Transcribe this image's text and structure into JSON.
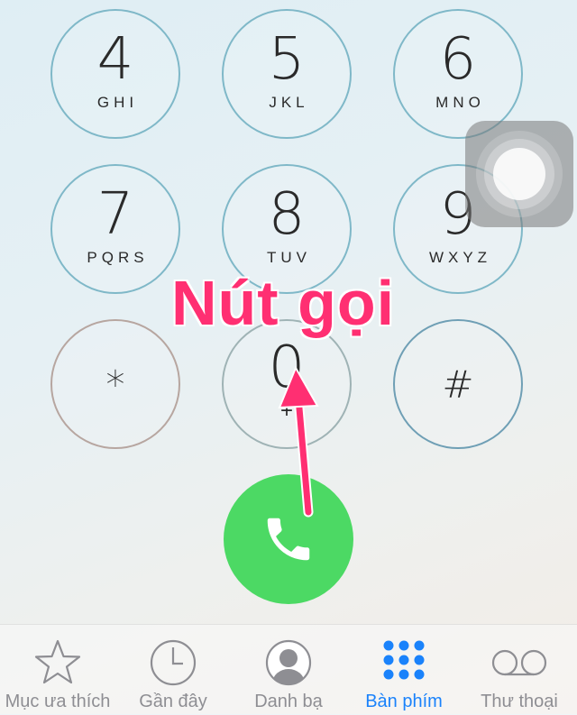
{
  "keypad": {
    "k4": {
      "digit": "4",
      "letters": "GHI"
    },
    "k5": {
      "digit": "5",
      "letters": "JKL"
    },
    "k6": {
      "digit": "6",
      "letters": "MNO"
    },
    "k7": {
      "digit": "7",
      "letters": "PQRS"
    },
    "k8": {
      "digit": "8",
      "letters": "TUV"
    },
    "k9": {
      "digit": "9",
      "letters": "WXYZ"
    },
    "kstar": {
      "symbol": "*"
    },
    "k0": {
      "digit": "0",
      "letters": "+"
    },
    "khash": {
      "symbol": "#"
    }
  },
  "call_button": {
    "icon": "phone-icon",
    "color": "#4cd964"
  },
  "annotation": {
    "text": "Nút gọi",
    "color": "#ff2f72"
  },
  "tabbar": {
    "favorites": "Mục ưa thích",
    "recents": "Gần đây",
    "contacts": "Danh bạ",
    "keypad": "Bàn phím",
    "voicemail": "Thư thoại",
    "active_color": "#1a82fb"
  }
}
